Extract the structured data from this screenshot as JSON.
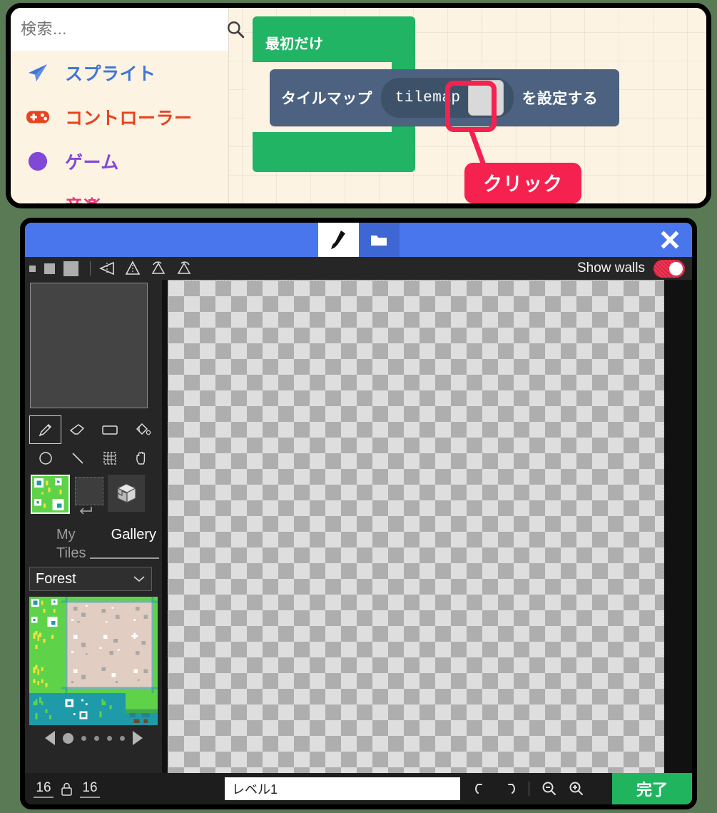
{
  "colors": {
    "page_background": "#5a7a55",
    "workspace_background": "#fdf3e3",
    "onstart_block": "#21b464",
    "tilemap_block": "#4c6280",
    "highlight_red": "#f5224f",
    "editor_header_blue": "#4a76ed",
    "editor_dark": "#262626",
    "done_green": "#20b45f",
    "toggle_on_red": "#e02040"
  },
  "toolbox": {
    "search": {
      "placeholder": "検索...",
      "value": "",
      "icon": "search-icon"
    },
    "categories": [
      {
        "label": "スプライト",
        "color": "#4075d8",
        "icon": "paper-plane-icon"
      },
      {
        "label": "コントローラー",
        "color": "#e8431f",
        "icon": "gamepad-icon"
      },
      {
        "label": "ゲーム",
        "color": "#8148d8",
        "icon": "circle-icon"
      },
      {
        "label": "音楽",
        "color": "#e8387f",
        "icon": "music-arc-icon"
      }
    ]
  },
  "workspace": {
    "on_start_block": {
      "label": "最初だけ"
    },
    "set_tilemap_block": {
      "prefix": "タイルマップ",
      "field_name": "tilemap",
      "suffix": "を設定する",
      "swatch_value": ""
    },
    "callout": {
      "text": "クリック"
    }
  },
  "editor": {
    "tabs": [
      {
        "name": "paint-tab",
        "icon": "paintbrush-icon",
        "active": true
      },
      {
        "name": "assets-tab",
        "icon": "folder-icon",
        "active": false
      }
    ],
    "close_label": "✕",
    "toolbar": {
      "sizes": [
        "small",
        "medium",
        "large"
      ],
      "transforms": [
        "flip-horizontal-icon",
        "flip-vertical-icon",
        "rotate-left-icon",
        "rotate-right-icon"
      ],
      "show_walls": {
        "label": "Show walls",
        "on": true
      }
    },
    "sidebar": {
      "tools": [
        {
          "name": "pencil-tool",
          "icon": "pencil-icon",
          "selected": true
        },
        {
          "name": "eraser-tool",
          "icon": "eraser-icon",
          "selected": false
        },
        {
          "name": "rectangle-tool",
          "icon": "rectangle-icon",
          "selected": false
        },
        {
          "name": "fill-tool",
          "icon": "paint-bucket-icon",
          "selected": false
        },
        {
          "name": "circle-tool",
          "icon": "circle-outline-icon",
          "selected": false
        },
        {
          "name": "line-tool",
          "icon": "line-icon",
          "selected": false
        },
        {
          "name": "marquee-tool",
          "icon": "marquee-icon",
          "selected": false
        },
        {
          "name": "pan-tool",
          "icon": "hand-icon",
          "selected": false
        }
      ],
      "gallery_tabs": [
        {
          "label": "My Tiles",
          "active": false
        },
        {
          "label": "Gallery",
          "active": true
        }
      ],
      "theme_select": {
        "value": "Forest",
        "icon": "chevron-down-icon"
      },
      "tiles": [
        {
          "name": "grass-flowers",
          "base": "#5ed34a",
          "accent": "#ffffff",
          "accent2": "#f2e23c"
        },
        {
          "name": "sand-edge-tl",
          "base": "#e2cdc2",
          "accent": "#ffffff",
          "accent2": "#a8a8a8"
        },
        {
          "name": "sand-edge-t",
          "base": "#e2cdc2",
          "accent": "#ffffff",
          "accent2": "#a8a8a8"
        },
        {
          "name": "sand-edge-tr",
          "base": "#e2cdc2",
          "accent": "#ffffff",
          "accent2": "#a8a8a8"
        },
        {
          "name": "grass-tufts",
          "base": "#5ed34a",
          "accent": "#f2e23c",
          "accent2": "#f2e23c"
        },
        {
          "name": "sand-edge-l",
          "base": "#e2cdc2",
          "accent": "#ffffff",
          "accent2": "#a8a8a8"
        },
        {
          "name": "sand-center",
          "base": "#e2cdc2",
          "accent": "#ffffff",
          "accent2": "#a8a8a8"
        },
        {
          "name": "sand-edge-r",
          "base": "#e2cdc2",
          "accent": "#ffffff",
          "accent2": "#a8a8a8"
        },
        {
          "name": "grass-weeds",
          "base": "#5ed34a",
          "accent": "#f2e23c",
          "accent2": "#f2e23c"
        },
        {
          "name": "sand-edge-bl",
          "base": "#e2cdc2",
          "accent": "#ffffff",
          "accent2": "#a8a8a8"
        },
        {
          "name": "sand-edge-b",
          "base": "#e2cdc2",
          "accent": "#ffffff",
          "accent2": "#a8a8a8"
        },
        {
          "name": "sand-edge-br",
          "base": "#e2cdc2",
          "accent": "#ffffff",
          "accent2": "#a8a8a8"
        },
        {
          "name": "water-reeds",
          "base": "#1f9aa8",
          "accent": "#5ed34a",
          "accent2": "#2d7f8c"
        },
        {
          "name": "water-lilies",
          "base": "#1f9aa8",
          "accent": "#ffffff",
          "accent2": "#5ed34a"
        },
        {
          "name": "water-grass",
          "base": "#1f9aa8",
          "accent": "#5ed34a",
          "accent2": "#2d7f8c"
        },
        {
          "name": "cliff-edge",
          "base": "#1f9aa8",
          "accent": "#5ed34a",
          "accent2": "#3a2a1e"
        }
      ],
      "pager": {
        "pages": 5,
        "current": 1,
        "prev_icon": "triangle-left-icon",
        "next_icon": "triangle-right-icon"
      }
    },
    "bottom": {
      "width": "16",
      "height": "16",
      "lock_icon": "lock-icon",
      "name_input": {
        "value": "レベル1",
        "placeholder": ""
      },
      "undo_icon": "undo-icon",
      "redo_icon": "redo-icon",
      "zoom_out_icon": "zoom-out-icon",
      "zoom_in_icon": "zoom-in-icon",
      "done_label": "完了"
    }
  }
}
